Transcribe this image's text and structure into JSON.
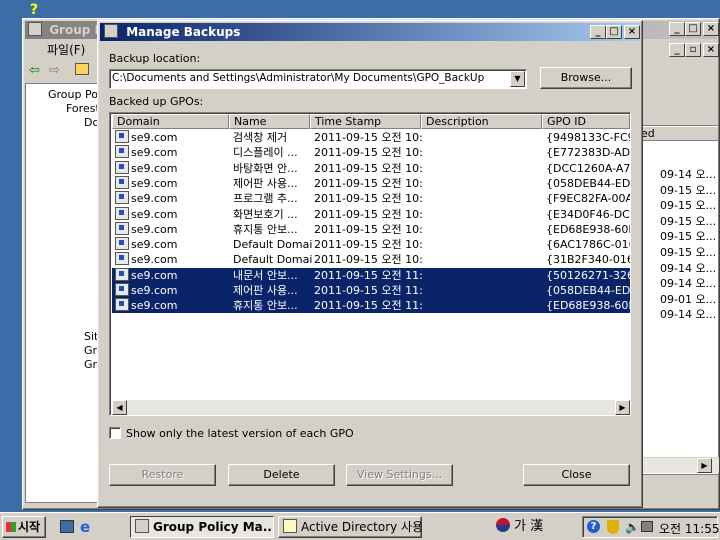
{
  "gp_window": {
    "title": "Group Po",
    "menu_file": "파일(F)",
    "tree": [
      "Group Po",
      "Forest",
      "Do",
      "Site",
      "Gro",
      "Gro"
    ],
    "right_header": "ed",
    "right_dates": [
      "09-14 오...",
      "09-15 오...",
      "09-15 오...",
      "09-15 오...",
      "09-15 오...",
      "09-15 오...",
      "09-14 오...",
      "09-14 오...",
      "09-01 오...",
      "09-14 오..."
    ]
  },
  "dialog": {
    "title": "Manage Backups",
    "backup_location_label": "Backup location:",
    "backup_location_value": "C:\\Documents and Settings\\Administrator\\My Documents\\GPO_BackUp",
    "browse_label": "Browse...",
    "backed_up_label": "Backed up GPOs:",
    "columns": [
      "Domain",
      "Name",
      "Time Stamp",
      "Description",
      "GPO ID"
    ],
    "rows": [
      {
        "domain": "se9.com",
        "name": "검색창 제거",
        "ts": "2011-09-15 오전 10:...",
        "desc": "",
        "id": "{9498133C-FC9...",
        "sel": false
      },
      {
        "domain": "se9.com",
        "name": "디스플레이 ...",
        "ts": "2011-09-15 오전 10:...",
        "desc": "",
        "id": "{E772383D-AD...",
        "sel": false
      },
      {
        "domain": "se9.com",
        "name": "바탕화면 안...",
        "ts": "2011-09-15 오전 10:...",
        "desc": "",
        "id": "{DCC1260A-A7...",
        "sel": false
      },
      {
        "domain": "se9.com",
        "name": "제어판 사용...",
        "ts": "2011-09-15 오전 10:...",
        "desc": "",
        "id": "{058DEB44-ED...",
        "sel": false
      },
      {
        "domain": "se9.com",
        "name": "프로그램 추...",
        "ts": "2011-09-15 오전 10:...",
        "desc": "",
        "id": "{F9EC82FA-00A...",
        "sel": false
      },
      {
        "domain": "se9.com",
        "name": "화면보호기 ...",
        "ts": "2011-09-15 오전 10:...",
        "desc": "",
        "id": "{E34D0F46-DC...",
        "sel": false
      },
      {
        "domain": "se9.com",
        "name": "휴지통 안보...",
        "ts": "2011-09-15 오전 10:...",
        "desc": "",
        "id": "{ED68E938-60B...",
        "sel": false
      },
      {
        "domain": "se9.com",
        "name": "Default Domai...",
        "ts": "2011-09-15 오전 10:...",
        "desc": "",
        "id": "{6AC1786C-016...",
        "sel": false
      },
      {
        "domain": "se9.com",
        "name": "Default Domai...",
        "ts": "2011-09-15 오전 10:...",
        "desc": "",
        "id": "{31B2F340-016...",
        "sel": false
      },
      {
        "domain": "se9.com",
        "name": "내문서 안보...",
        "ts": "2011-09-15 오전 11:...",
        "desc": "",
        "id": "{50126271-326...",
        "sel": true
      },
      {
        "domain": "se9.com",
        "name": "제어판 사용...",
        "ts": "2011-09-15 오전 11:...",
        "desc": "",
        "id": "{058DEB44-ED...",
        "sel": true
      },
      {
        "domain": "se9.com",
        "name": "휴지통 안보...",
        "ts": "2011-09-15 오전 11:...",
        "desc": "",
        "id": "{ED68E938-60B...",
        "sel": true
      }
    ],
    "checkbox_label": "Show only the latest version of each GPO",
    "restore_label": "Restore",
    "delete_label": "Delete",
    "view_settings_label": "View Settings...",
    "close_label": "Close"
  },
  "taskbar": {
    "start_label": "시작",
    "items": [
      "Group Policy Ma...",
      "Active Directory 사용..."
    ],
    "ime": "가 漢",
    "clock": "오전 11:55"
  }
}
